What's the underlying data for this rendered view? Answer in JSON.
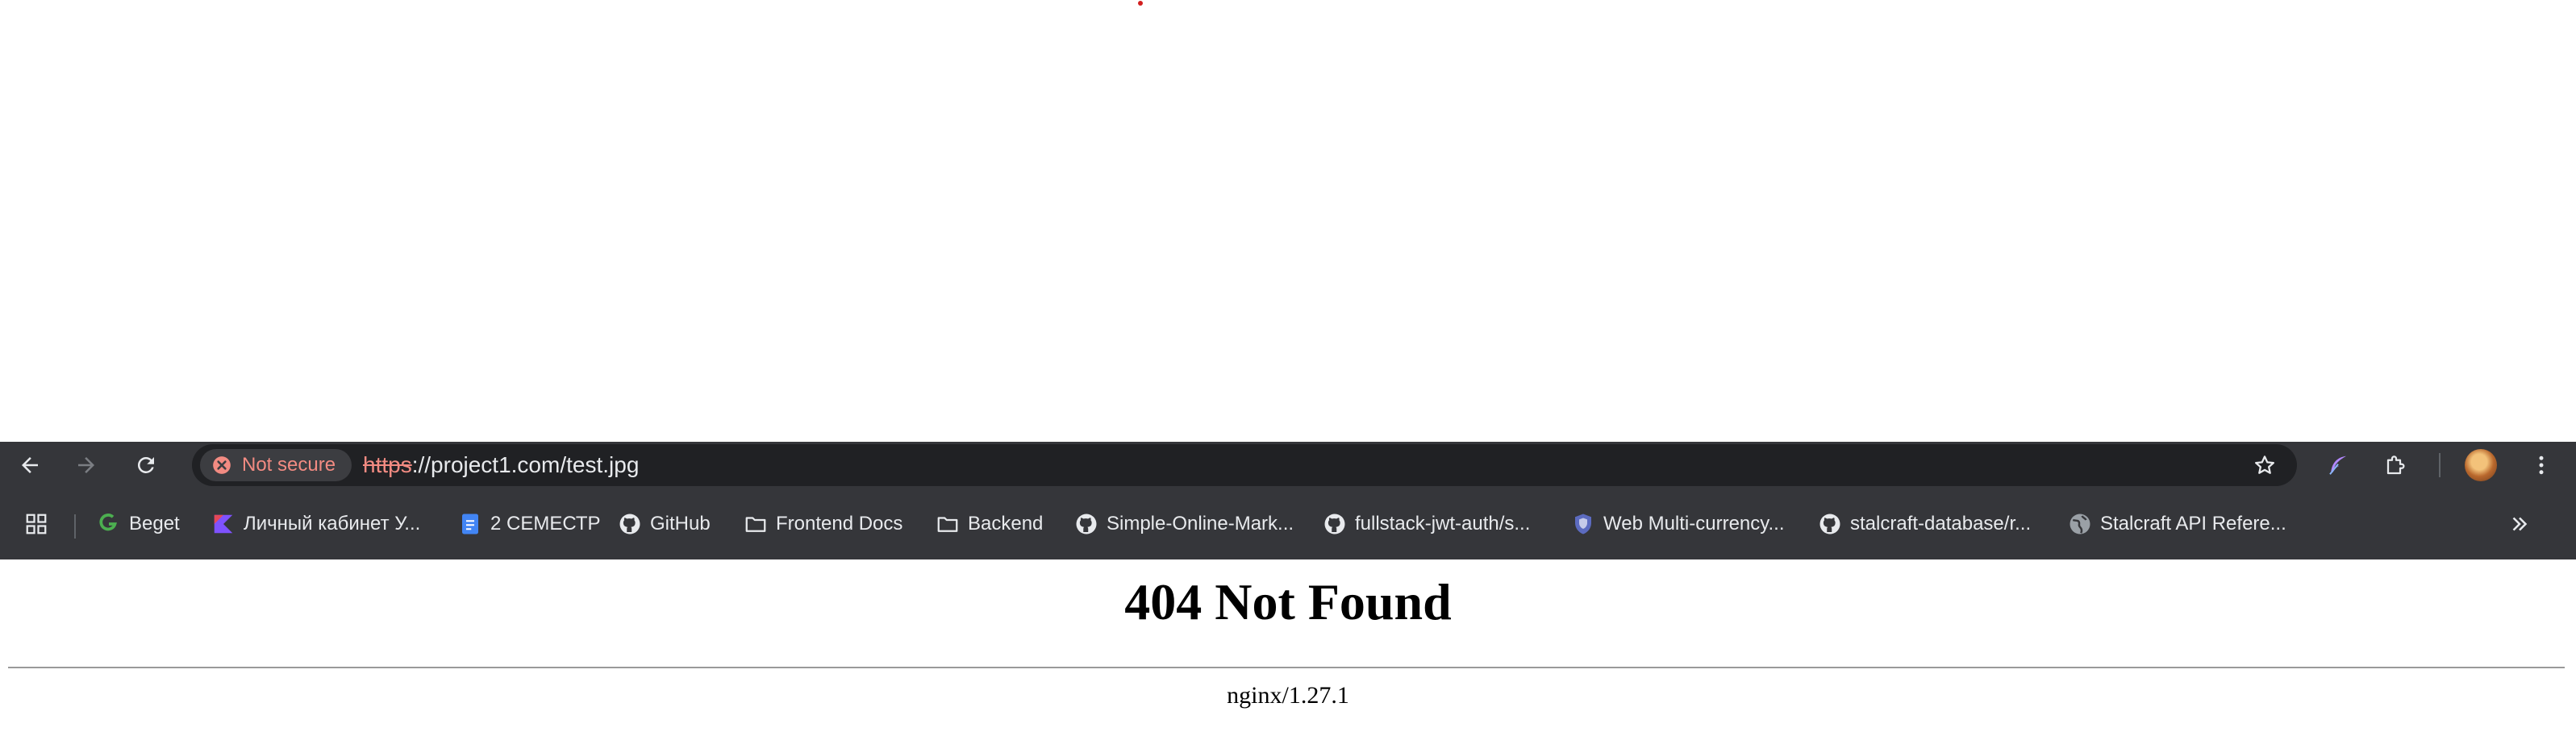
{
  "page": {
    "background": "#ffffff",
    "accent_dot_color": "#d21f1f"
  },
  "toolbar": {
    "back_icon": "arrow-left-icon",
    "forward_icon": "arrow-right-icon",
    "reload_icon": "reload-icon",
    "security": {
      "label": "Not secure",
      "icon": "error-circle-icon",
      "color": "#f28b82"
    },
    "url": {
      "scheme": "https",
      "rest": "://project1.com/test.jpg"
    },
    "bookmark_star_icon": "star-icon",
    "extension_icons": [
      "feather-icon",
      "puzzle-icon"
    ],
    "menu_icon": "more-vertical-icon"
  },
  "bookmarks": {
    "apps_icon": "apps-grid-icon",
    "items": [
      {
        "label": "Beget",
        "icon": "beget-icon"
      },
      {
        "label": "Личный кабинет У...",
        "icon": "kotlin-icon"
      },
      {
        "label": "2 СЕМЕСТР",
        "icon": "google-docs-icon"
      },
      {
        "label": "GitHub",
        "icon": "github-icon"
      },
      {
        "label": "Frontend Docs",
        "icon": "folder-icon"
      },
      {
        "label": "Backend",
        "icon": "folder-icon"
      },
      {
        "label": "Simple-Online-Mark...",
        "icon": "github-icon"
      },
      {
        "label": "fullstack-jwt-auth/s...",
        "icon": "github-icon"
      },
      {
        "label": "Web Multi-currency...",
        "icon": "shield-icon"
      },
      {
        "label": "stalcraft-database/r...",
        "icon": "github-icon"
      },
      {
        "label": "Stalcraft API Refere...",
        "icon": "globe-icon"
      }
    ],
    "overflow_icon": "chevron-double-right-icon"
  },
  "content": {
    "heading": "404 Not Found",
    "server": "nginx/1.27.1"
  }
}
